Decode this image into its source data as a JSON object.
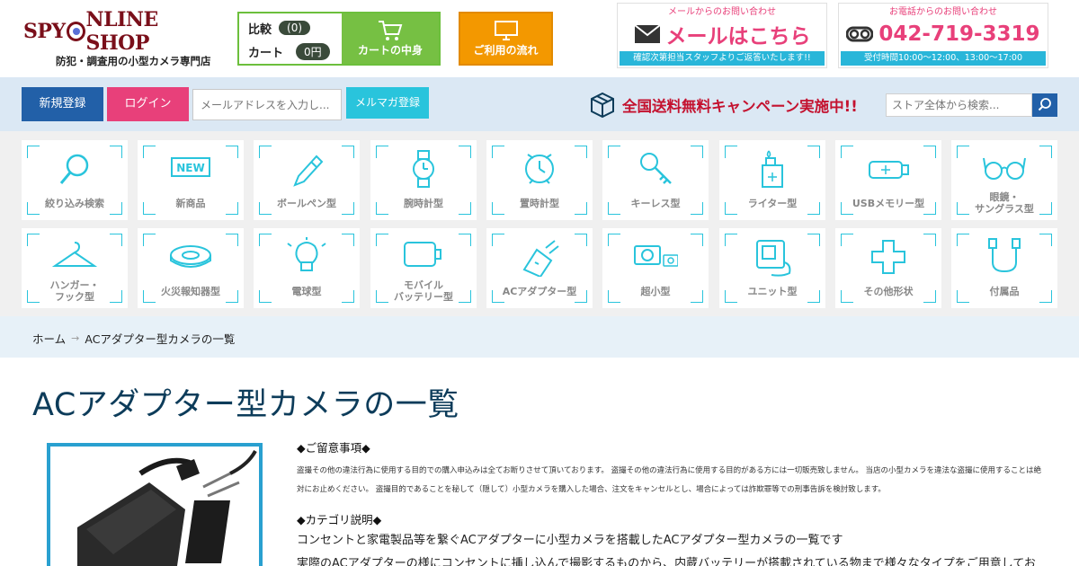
{
  "header": {
    "logo_main": "SPY ONLINE SHOP",
    "logo_sub": "防犯・調査用の小型カメラ専門店",
    "compare_label": "比較",
    "compare_count": "(0)",
    "cart_label": "カート",
    "cart_amount": "0円",
    "cart_button_label": "カートの中身",
    "flow_button_label": "ご利用の流れ",
    "mail_contact": {
      "label": "メールからのお問い合わせ",
      "main": "メールはこちら",
      "footer": "確認次第担当スタッフよりご返答いたします!!"
    },
    "phone_contact": {
      "label": "お電話からのお問い合わせ",
      "main": "042-719-3319",
      "footer": "受付時間10:00～12:00、13:00～17:00"
    }
  },
  "navbar": {
    "register_label": "新規登録",
    "login_label": "ログイン",
    "mail_placeholder": "メールアドレスを入力し...",
    "magazine_label": "メルマガ登録",
    "campaign_text": "全国送料無料キャンペーン実施中!!",
    "search_placeholder": "ストア全体から検索..."
  },
  "categories": [
    {
      "label": "絞り込み検索",
      "icon": "magnifier-icon"
    },
    {
      "label": "新商品",
      "icon": "new-badge-icon"
    },
    {
      "label": "ボールペン型",
      "icon": "pen-icon"
    },
    {
      "label": "腕時計型",
      "icon": "wristwatch-icon"
    },
    {
      "label": "置時計型",
      "icon": "alarm-clock-icon"
    },
    {
      "label": "キーレス型",
      "icon": "key-icon"
    },
    {
      "label": "ライター型",
      "icon": "lighter-icon"
    },
    {
      "label": "USBメモリー型",
      "icon": "usb-icon"
    },
    {
      "label": "眼鏡・\nサングラス型",
      "icon": "glasses-icon"
    },
    {
      "label": "ハンガー・\nフック型",
      "icon": "hanger-icon"
    },
    {
      "label": "火災報知器型",
      "icon": "smoke-detector-icon"
    },
    {
      "label": "電球型",
      "icon": "bulb-icon"
    },
    {
      "label": "モバイル\nバッテリー型",
      "icon": "battery-icon"
    },
    {
      "label": "ACアダプター型",
      "icon": "ac-adapter-icon"
    },
    {
      "label": "超小型",
      "icon": "mini-camera-icon"
    },
    {
      "label": "ユニット型",
      "icon": "unit-icon"
    },
    {
      "label": "その他形状",
      "icon": "other-shape-icon"
    },
    {
      "label": "付属品",
      "icon": "accessory-cable-icon"
    }
  ],
  "breadcrumb": {
    "home": "ホーム",
    "current": "ACアダプター型カメラの一覧"
  },
  "main": {
    "title": "ACアダプター型カメラの一覧",
    "notice_heading": "◆ご留意事項◆",
    "notice_text": "盗撮その他の違法行為に使用する目的での購入申込みは全てお断りさせて頂いております。 盗撮その他の違法行為に使用する目的がある方には一切販売致しません。 当店の小型カメラを違法な盗撮に使用することは絶対にお止めください。 盗撮目的であることを秘して（隠して）小型カメラを購入した場合、注文をキャンセルとし、場合によっては詐欺罪等での刑事告訴を検討致します。",
    "category_heading": "◆カテゴリ説明◆",
    "category_desc1": "コンセントと家電製品等を繋ぐACアダプターに小型カメラを搭載したACアダプター型カメラの一覧です",
    "category_desc2": "実際のACアダプターの様にコンセントに挿し込んで撮影するものから、内蔵バッテリーが搭載されている物まで様々なタイプをご用意してお"
  },
  "colors": {
    "accent_blue": "#2260a8",
    "accent_pink": "#e8407a",
    "cyan": "#29c4dc",
    "green": "#76c043",
    "orange": "#f39800",
    "campaign_red": "#c4122f"
  }
}
